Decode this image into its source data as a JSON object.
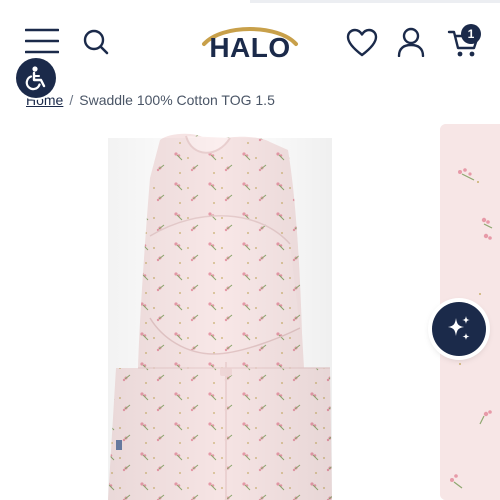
{
  "header": {
    "logo_text": "HALO",
    "menu_icon": "hamburger-menu-icon",
    "search_icon": "search-icon",
    "wishlist_icon": "heart-icon",
    "account_icon": "user-icon",
    "cart_icon": "cart-icon",
    "cart_count": "1"
  },
  "accessibility": {
    "icon": "wheelchair-icon"
  },
  "breadcrumb": {
    "home": "Home",
    "separator": "/",
    "current": "Swaddle 100% Cotton TOG 1.5"
  },
  "product": {
    "main_image": "swaddle-pink-floral-image",
    "side_image": "fabric-detail-image"
  },
  "assistant": {
    "icon": "sparkle-icon"
  },
  "colors": {
    "navy": "#1b2a4a",
    "gold": "#c8a04a",
    "swaddle_pink": "#f6e4e4",
    "flower_pink": "#e79aa8",
    "leaf_green": "#8fa870"
  }
}
